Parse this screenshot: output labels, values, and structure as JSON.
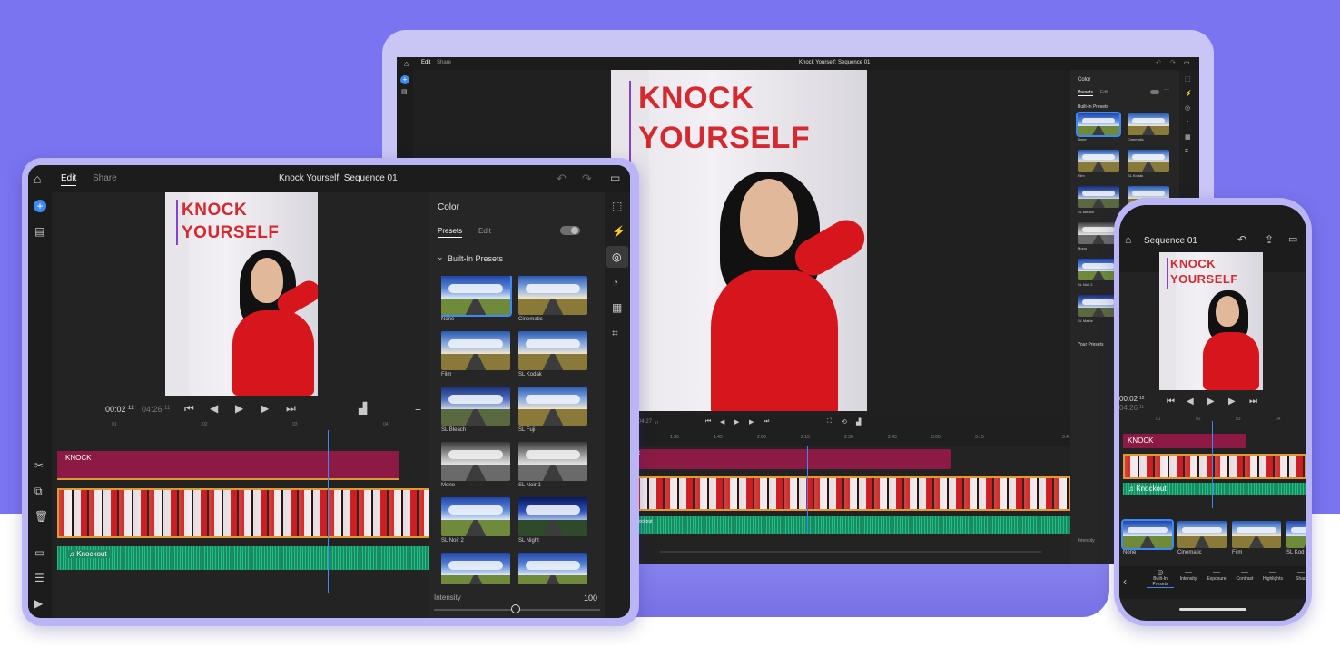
{
  "colors": {
    "background": "#7b74f0",
    "device_frame": "#b9b5f6",
    "app_bg": "#232323",
    "panel_bg": "#262626",
    "accent_blue": "#3d8af7",
    "title_track": "#8c1a44",
    "video_track": "#e09a33",
    "audio_track": "#1a8a62",
    "overlay_text": "#d42a2f"
  },
  "overlay": {
    "line1": "KNOCK",
    "line2": "YOURSELF"
  },
  "laptop": {
    "tabs": [
      "Edit",
      "Share"
    ],
    "title": "Knock Yourself: Sequence 01",
    "panel": {
      "title": "Color",
      "tabs": [
        "Presets",
        "Edit"
      ],
      "section": "Built-In Presets",
      "presets": [
        "None",
        "Cinematic",
        "Film",
        "SL Kodak",
        "SL Bleach",
        "SL Fuji",
        "Mono",
        "SL Noir 1",
        "SL Noir 2",
        "SL Night",
        "SL Matrix",
        ""
      ],
      "your_presets": "Your Presets",
      "intensity": "Intensity"
    },
    "timecode": "04:27",
    "timecode_frames": "07",
    "ruler": [
      "1:30",
      "1:45",
      "2:00",
      "2:15",
      "2:30",
      "2:45",
      "3:00",
      "3:15",
      "3:4"
    ],
    "title_clip": "K",
    "audio_clip": "nockout"
  },
  "tablet": {
    "tabs": [
      "Edit",
      "Share"
    ],
    "title": "Knock Yourself: Sequence 01",
    "timecode_current": "00:02",
    "timecode_current_frames": "12",
    "timecode_total": "04:26",
    "timecode_total_frames": "11",
    "ruler": [
      "01",
      "02",
      "03",
      "04"
    ],
    "title_clip": "KNOCK",
    "audio_clip": "Knockout",
    "panel": {
      "title": "Color",
      "tabs": [
        "Presets",
        "Edit"
      ],
      "more": "···",
      "section": "Built-In Presets",
      "presets": [
        "None",
        "Cinematic",
        "Film",
        "SL Kodak",
        "SL Bleach",
        "SL Fuji",
        "Mono",
        "SL Noir 1",
        "SL Noir 2",
        "SL Night",
        "",
        ""
      ],
      "intensity_label": "Intensity",
      "intensity_value": "100",
      "intensity": 1.0
    },
    "side_tools": [
      "shape-icon",
      "speed-icon",
      "color-icon",
      "gauge-icon",
      "grid-icon",
      "crop-icon"
    ],
    "left_tools": [
      "scissors-icon",
      "duplicate-icon",
      "trash-icon",
      "media-icon",
      "list-icon",
      "add-media-icon"
    ]
  },
  "phone": {
    "title": "Sequence 01",
    "timecode_current": "00:02",
    "timecode_current_frames": "12",
    "timecode_total": "04:26",
    "timecode_total_frames": "11",
    "ruler": [
      "01",
      "02",
      "03",
      "04"
    ],
    "title_clip": "KNOCK",
    "audio_clip": "Knockout",
    "presets": [
      "None",
      "Cinematic",
      "Film",
      "SL Kod"
    ],
    "tools": [
      "Built-In Presets",
      "Intensity",
      "Exposure",
      "Contrast",
      "Highlights",
      "Shad"
    ]
  }
}
